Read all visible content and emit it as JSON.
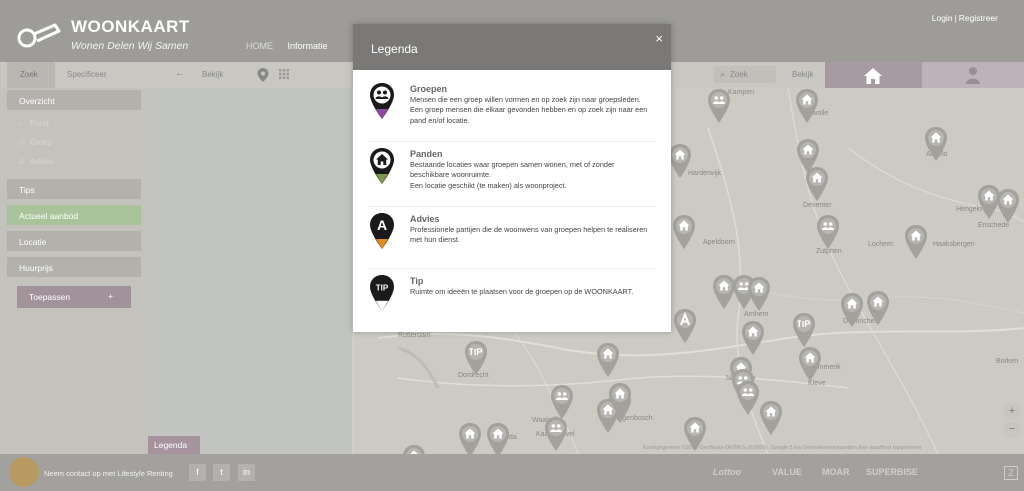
{
  "header": {
    "title": "WOONKAART",
    "subtitle": "Wonen Delen Wij Samen",
    "nav": [
      "HOME",
      "Informatie"
    ],
    "login": "Login",
    "separator": "|",
    "register": "Registreer"
  },
  "toolbar": {
    "zoek": "Zoek",
    "specificeer": "Specificeer",
    "bekijk": "Bekijk",
    "search_placeholder": "Zoek",
    "bekijk_right": "Bekijk"
  },
  "sidebar": {
    "overview": "Overzicht",
    "sub_items": [
      "Pand",
      "Groep",
      "Advies"
    ],
    "items": [
      "Tips",
      "Actueel aanbod",
      "Locatie",
      "Huurprijs"
    ],
    "apply": "Toepassen",
    "apply_icon": "+"
  },
  "map": {
    "cities": [
      "Kampen",
      "Zwolle",
      "Apeldoorn",
      "Deventer",
      "Zutphen",
      "Lochem",
      "Hengelo",
      "Enschede",
      "Almelo",
      "Haaksbergen",
      "Arnhem",
      "Nijmegen",
      "Doetinchem",
      "Emmerik",
      "Kleve",
      "Rotterdam",
      "Dordrecht",
      "Waalwijk",
      "'s-Hertogenbosch",
      "Kaatsheuvel",
      "Harderwijk",
      "Breda",
      "Borken"
    ],
    "legenda_tab": "Legenda",
    "zoom_in": "+",
    "zoom_out": "−",
    "attribution": "Kaartgegevens ©2015 GeoBasis-DE/BKG (©2009), Google   5 km   Gebruiksvoorwaarden   Een kaartfout rapporteren"
  },
  "footer": {
    "contact": "Neem contact op met Lifestyle Renting",
    "social": [
      "f",
      "t",
      "in"
    ],
    "partners": [
      "Lottoo",
      "VALUE",
      "MOAR",
      "SUPERBISE"
    ],
    "corner": "Z"
  },
  "modal": {
    "title": "Legenda",
    "close": "×",
    "entries": [
      {
        "title": "Groepen",
        "description": "Mensen die een groep willen vormen en op zoek zijn naar groepsleden. Een groep mensen die elkaar gevonden hebben en op zoek zijn naar een pand en/of locatie.",
        "icon": "group-pin-icon",
        "color": "#8e4a9c"
      },
      {
        "title": "Panden",
        "description": "Bestaande locaties waar groepen samen wonen, met of zonder beschikbare woonruimte.\nEen locatie geschikt (te maken) als woonproject.",
        "icon": "house-pin-icon",
        "color": "#7a9a4a"
      },
      {
        "title": "Advies",
        "description": "Professionele partijen die de woonwens van groepen helpen te realiseren met hun dienst.",
        "icon": "advice-pin-icon",
        "color": "#e08a1c",
        "glyph": "A"
      },
      {
        "title": "Tip",
        "description": "Ruimte om ideeën te plaatsen voor de groepen op de WOONKAART.",
        "icon": "tip-pin-icon",
        "color": "#ffffff",
        "glyph": "TIP"
      }
    ]
  }
}
